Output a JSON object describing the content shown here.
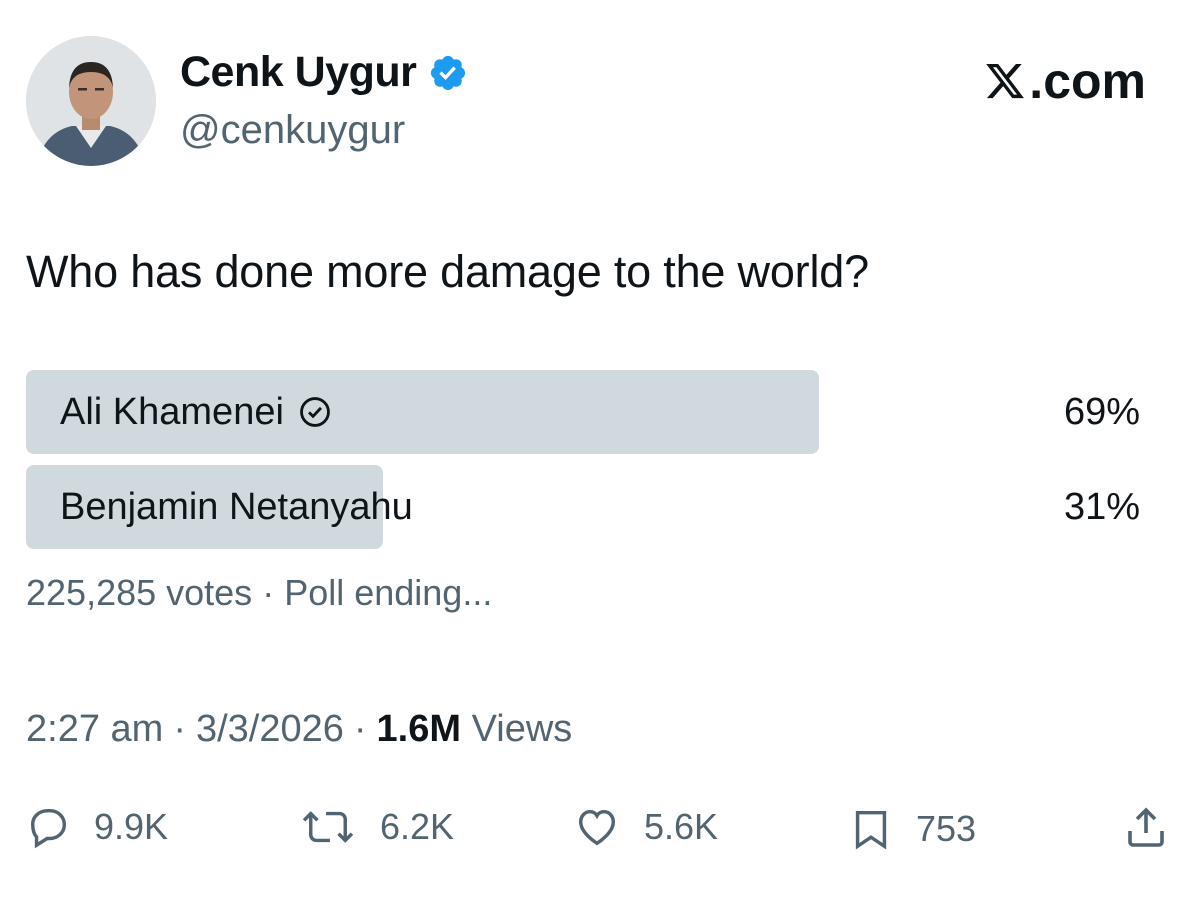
{
  "author": {
    "name": "Cenk Uygur",
    "handle": "@cenkuygur",
    "verified": true
  },
  "brand": {
    "label": ".com",
    "icon": "x-logo-icon"
  },
  "tweet": {
    "text": "Who has done more damage to the world?"
  },
  "poll": {
    "options": [
      {
        "label": "Ali Khamenei",
        "percent_text": "69%",
        "fraction": 0.69,
        "selected": true
      },
      {
        "label": "Benjamin Netanyahu",
        "percent_text": "31%",
        "fraction": 0.31,
        "selected": false
      }
    ],
    "votes": "225,285 votes",
    "separator": "·",
    "status": "Poll ending..."
  },
  "meta": {
    "time": "2:27 am",
    "date": "3/3/2026",
    "views_count": "1.6M",
    "views_label": "Views",
    "separator": "·"
  },
  "actions": {
    "replies": "9.9K",
    "reposts": "6.2K",
    "likes": "5.6K",
    "bookmarks": "753"
  },
  "colors": {
    "text": "#0f1419",
    "secondary": "#536471",
    "poll_fill": "#cfd9de",
    "verified_blue": "#1d9bf0"
  }
}
